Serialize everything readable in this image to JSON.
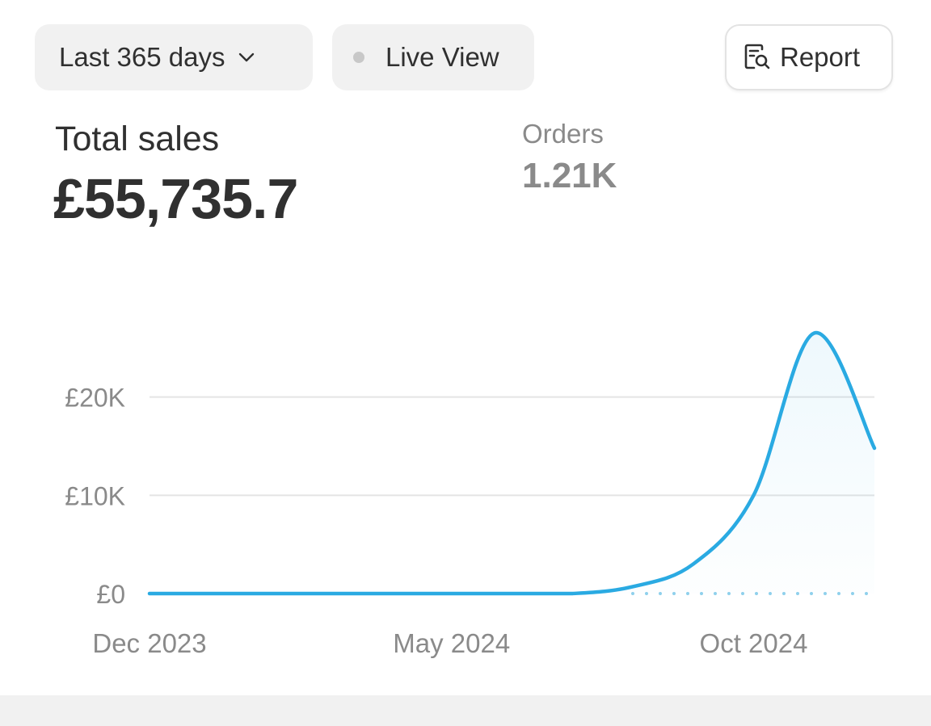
{
  "toolbar": {
    "period_label": "Last 365 days",
    "live_view_label": "Live View",
    "report_label": "Report",
    "icons": {
      "period_caret": "chevron-down-icon",
      "live_status": "status-dot-icon",
      "report": "report-search-icon"
    }
  },
  "metrics": {
    "total_sales_label": "Total sales",
    "total_sales_value": "£55,735.7",
    "orders_label": "Orders",
    "orders_value": "1.21K"
  },
  "colors": {
    "line": "#2aaae2",
    "baseline_dotted": "#8fd0ec",
    "gridline": "#e4e4e4",
    "text_muted": "#8a8a8a",
    "pill_bg": "#f1f1f1"
  },
  "chart_data": {
    "type": "area",
    "x_tick_labels": [
      "Dec 2023",
      "May 2024",
      "Oct 2024"
    ],
    "y_tick_labels": [
      "£0",
      "£10K",
      "£20K"
    ],
    "y_ticks": [
      0,
      10000,
      20000
    ],
    "ylim": [
      0,
      30000
    ],
    "grid": true,
    "legend": "none",
    "series": [
      {
        "points": [
          {
            "x": "2023-12",
            "y": 0
          },
          {
            "x": "2024-01",
            "y": 0
          },
          {
            "x": "2024-02",
            "y": 0
          },
          {
            "x": "2024-03",
            "y": 0
          },
          {
            "x": "2024-04",
            "y": 0
          },
          {
            "x": "2024-05",
            "y": 0
          },
          {
            "x": "2024-06",
            "y": 0
          },
          {
            "x": "2024-07",
            "y": 0
          },
          {
            "x": "2024-08",
            "y": 700
          },
          {
            "x": "2024-09",
            "y": 3000
          },
          {
            "x": "2024-10",
            "y": 10000
          },
          {
            "x": "2024-11",
            "y": 26500
          },
          {
            "x": "2024-12",
            "y": 14800
          }
        ]
      }
    ],
    "comparison_baseline": {
      "style": "dotted",
      "value": 0,
      "from": "2024-08",
      "to": "2024-12"
    }
  }
}
